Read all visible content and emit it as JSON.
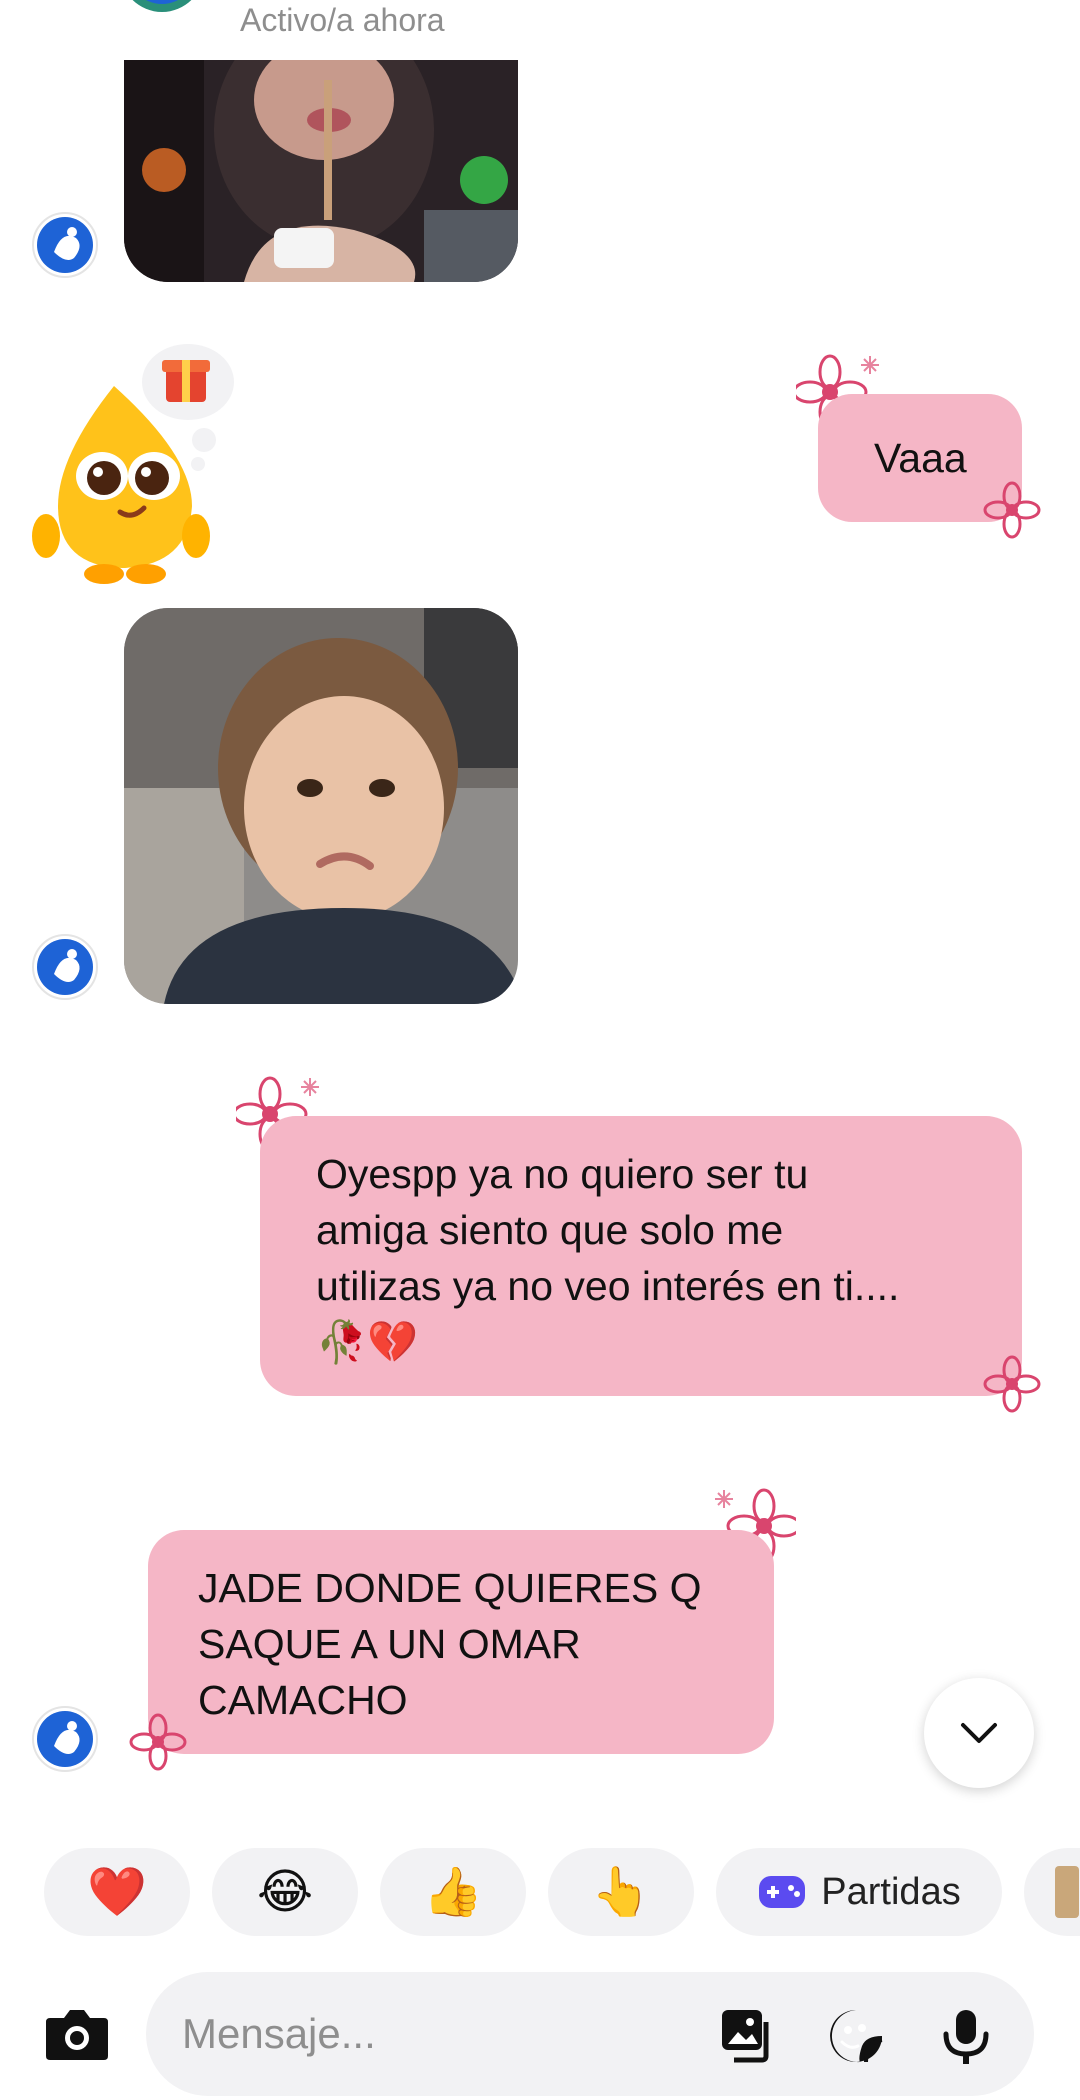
{
  "header": {
    "status": "Activo/a ahora"
  },
  "messages": [
    {
      "id": "photo-1",
      "type": "image",
      "from": "contact",
      "description_icon": "photo-girl-drinking"
    },
    {
      "id": "sticker",
      "type": "sticker",
      "from": "contact",
      "description_icon": "drop-mascot-sticker"
    },
    {
      "id": "msg-vaaa",
      "type": "text",
      "from": "me",
      "lines": [
        "Vaaa"
      ]
    },
    {
      "id": "photo-2",
      "type": "image",
      "from": "contact",
      "description_icon": "photo-sad-baby"
    },
    {
      "id": "msg-oyespp",
      "type": "text",
      "from": "me",
      "lines": [
        "Oyespp ya no quiero ser tu",
        "amiga siento que solo me",
        "utilizas ya no veo interés en ti....",
        "🥀💔"
      ]
    },
    {
      "id": "msg-jade",
      "type": "text",
      "from": "contact",
      "lines": [
        "JADE DONDE QUIERES Q",
        "SAQUE A UN OMAR",
        "CAMACHO"
      ]
    }
  ],
  "quick_reactions": [
    {
      "emoji": "❤️",
      "icon": "heart-icon"
    },
    {
      "emoji": "😂",
      "icon": "laughing-icon"
    },
    {
      "emoji": "👍",
      "icon": "thumbs-up-icon"
    },
    {
      "emoji": "👆",
      "icon": "pointing-up-icon"
    },
    {
      "label": "Partidas",
      "icon": "gamepad-icon"
    }
  ],
  "composer": {
    "placeholder": "Mensaje..."
  },
  "colors": {
    "bubble": "#f5b6c6",
    "flower": "#d9456e",
    "avatar_blue": "#1e63d6",
    "status_green": "#31c24a",
    "muted_text": "#8e8e8e"
  }
}
